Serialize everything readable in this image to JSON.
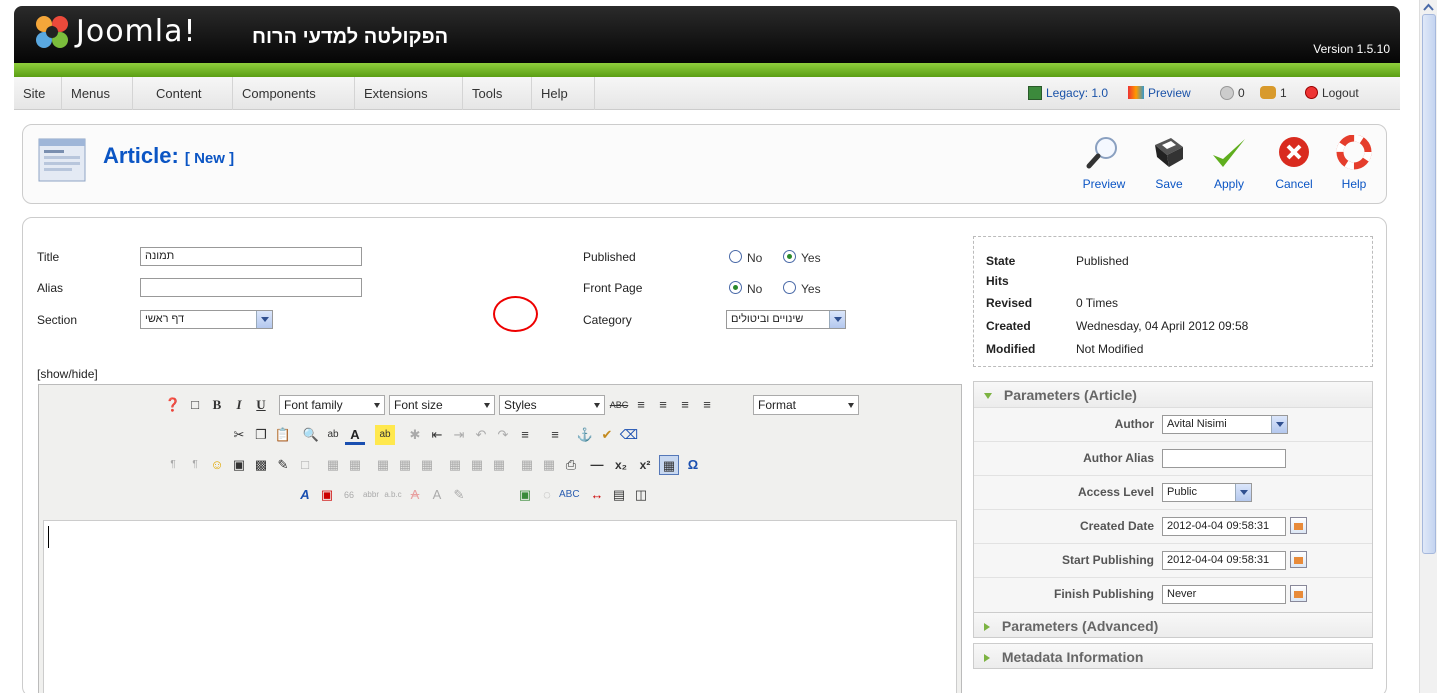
{
  "header": {
    "brand": "Joomla!",
    "site_name": "הפקולטה למדעי הרוח",
    "version": "Version 1.5.10"
  },
  "menu": [
    "Site",
    "Menus",
    "Content",
    "Components",
    "Extensions",
    "Tools",
    "Help"
  ],
  "status": {
    "legacy": "Legacy: 1.0",
    "preview": "Preview",
    "messages_count": "0",
    "users_count": "1",
    "logout": "Logout"
  },
  "page": {
    "title": "Article:",
    "subtitle": "[ New ]"
  },
  "toolbar": {
    "preview": "Preview",
    "save": "Save",
    "apply": "Apply",
    "cancel": "Cancel",
    "help": "Help"
  },
  "form": {
    "title_label": "Title",
    "title_value": "תמונה",
    "alias_label": "Alias",
    "alias_value": "",
    "section_label": "Section",
    "section_value": "דף ראשי",
    "published_label": "Published",
    "frontpage_label": "Front Page",
    "category_label": "Category",
    "category_value": "שינויים וביטולים",
    "no_label": "No",
    "yes_label": "Yes",
    "published_value": "Yes",
    "frontpage_value": "No"
  },
  "editor": {
    "showhide": "[show/hide]",
    "font_family": "Font family",
    "font_size": "Font size",
    "styles": "Styles",
    "format": "Format"
  },
  "info": {
    "state_label": "State",
    "state_value": "Published",
    "hits_label": "Hits",
    "hits_value": "",
    "revised_label": "Revised",
    "revised_value": "0 Times",
    "created_label": "Created",
    "created_value": "Wednesday, 04 April 2012 09:58",
    "modified_label": "Modified",
    "modified_value": "Not Modified"
  },
  "params": {
    "article_title": "Parameters (Article)",
    "author_label": "Author",
    "author_value": "Avital Nisimi",
    "author_alias_label": "Author Alias",
    "author_alias_value": "",
    "access_label": "Access Level",
    "access_value": "Public",
    "created_date_label": "Created Date",
    "created_date_value": "2012-04-04 09:58:31",
    "start_label": "Start Publishing",
    "start_value": "2012-04-04 09:58:31",
    "finish_label": "Finish Publishing",
    "finish_value": "Never",
    "advanced_title": "Parameters (Advanced)",
    "metadata_title": "Metadata Information"
  },
  "colors": {
    "brand_blue": "#0b55c4",
    "accent_green": "#6ab023",
    "highlight_red": "#e00000"
  }
}
